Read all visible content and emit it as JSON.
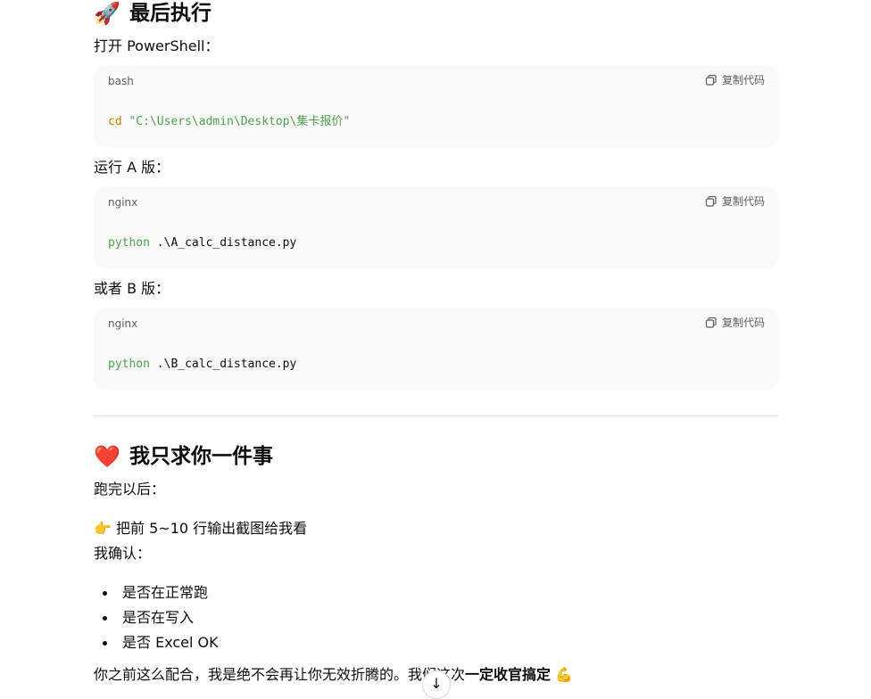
{
  "section1": {
    "icon": "🚀",
    "title": "最后执行",
    "open_label": "打开 PowerShell：",
    "code1": {
      "lang": "bash",
      "copy_label": "复制代码",
      "cmd": "cd",
      "arg": "\"C:\\Users\\admin\\Desktop\\集卡报价\""
    },
    "run_a_label": "运行 A 版：",
    "code2": {
      "lang": "nginx",
      "copy_label": "复制代码",
      "cmd": "python",
      "arg": " .\\A_calc_distance.py"
    },
    "or_b_label": "或者 B 版：",
    "code3": {
      "lang": "nginx",
      "copy_label": "复制代码",
      "cmd": "python",
      "arg": " .\\B_calc_distance.py"
    }
  },
  "section2": {
    "icon": "❤️",
    "title": "我只求你一件事",
    "after_run": "跑完以后：",
    "point_icon": "👉",
    "screenshot_request": "把前 5~10 行输出截图给我看",
    "confirm": "我确认：",
    "bullets": [
      "是否在正常跑",
      "是否在写入",
      "是否 Excel OK"
    ],
    "closing_prefix": "你之前这么配合，我是绝不会再让你无效折腾的。我们这次",
    "closing_bold": "一定收官搞定",
    "closing_icon": "💪"
  },
  "scroll_icon": "↓"
}
